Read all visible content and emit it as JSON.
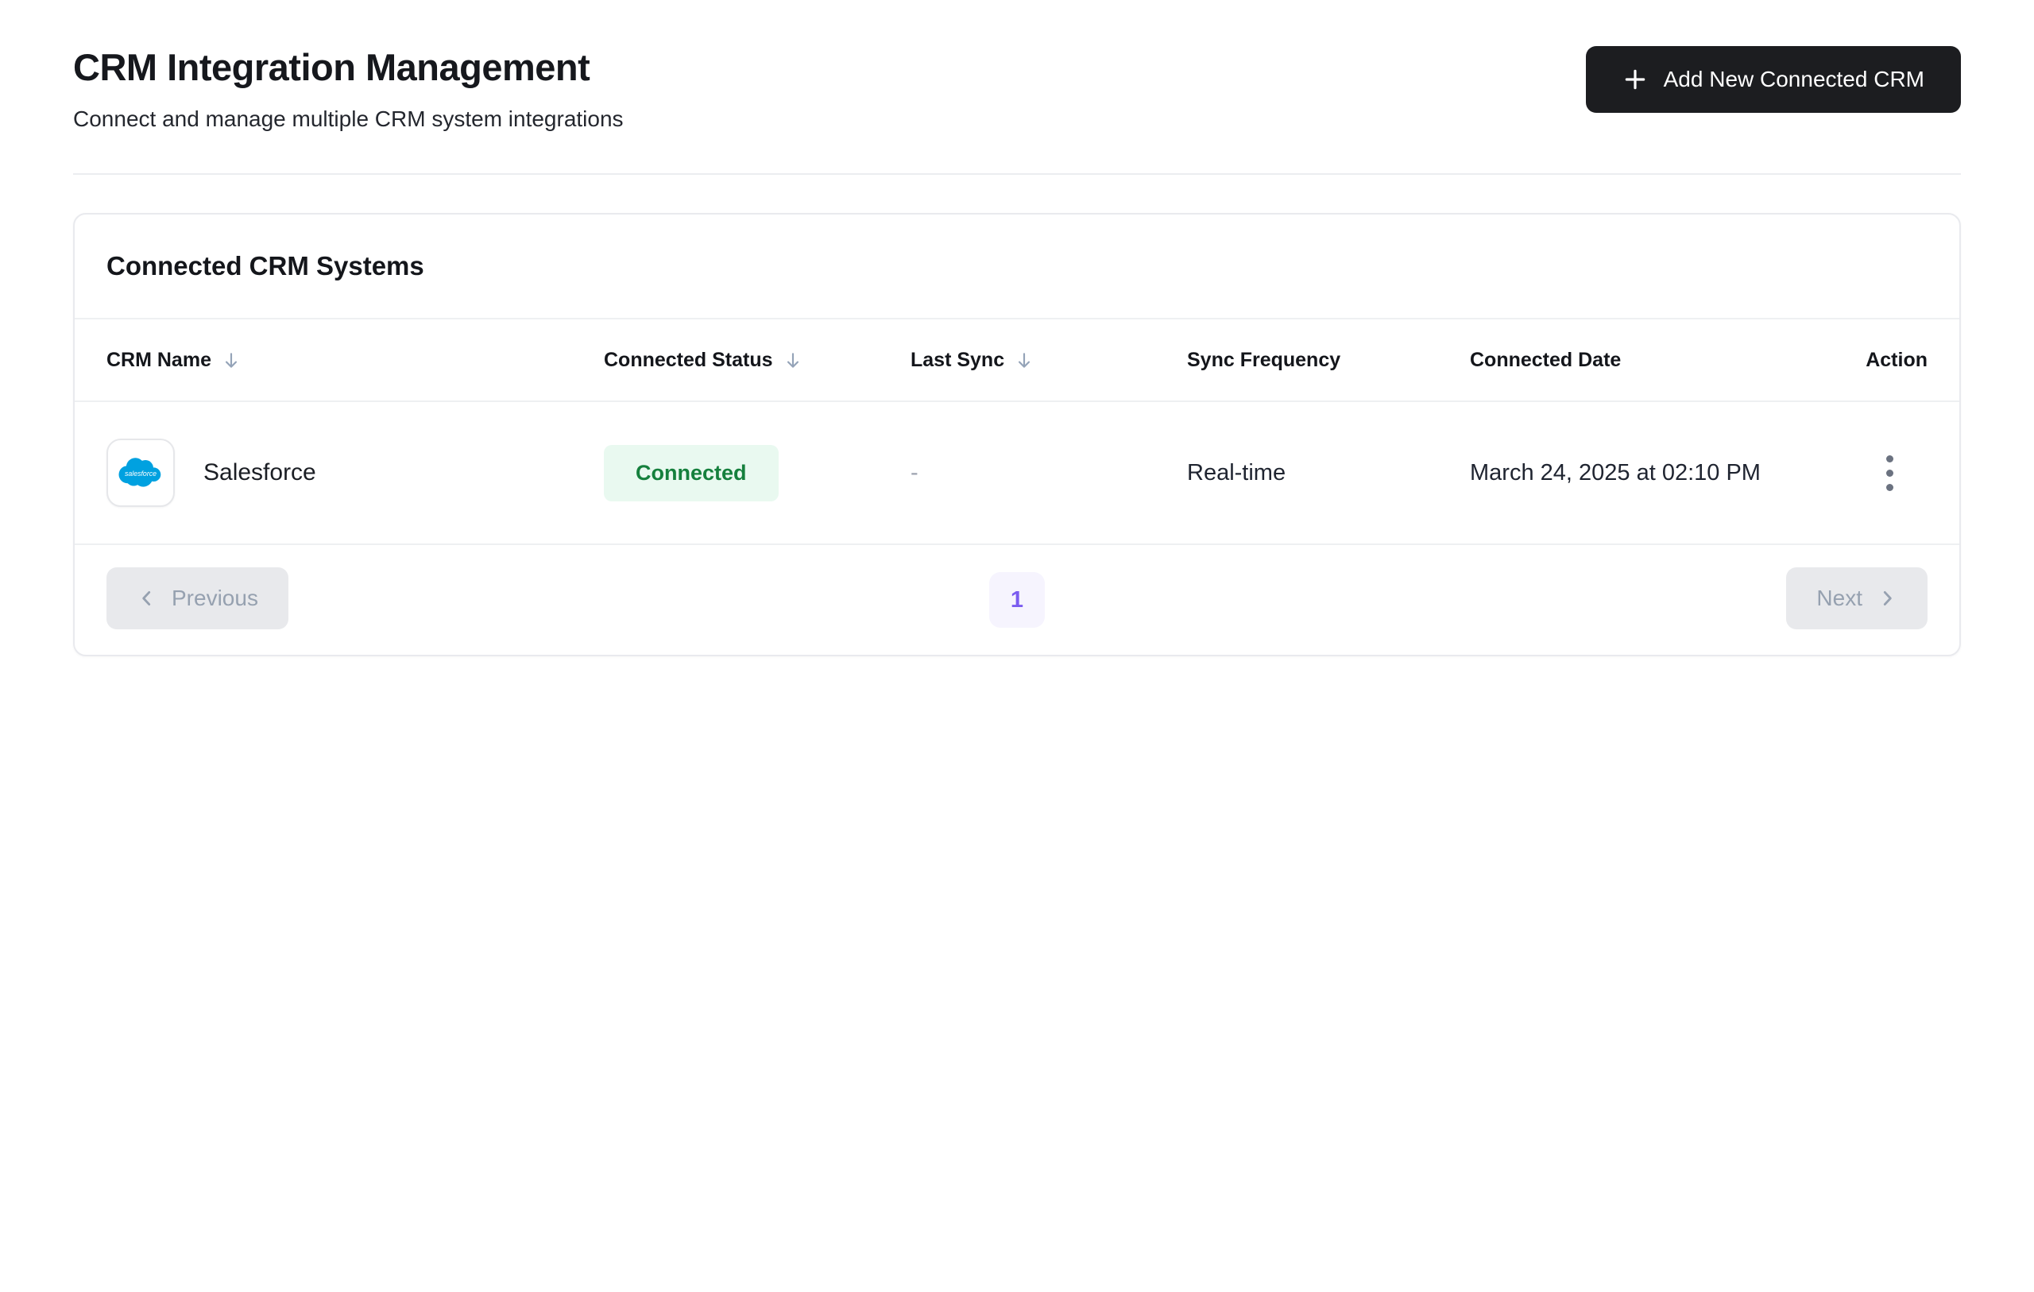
{
  "page": {
    "title": "CRM Integration Management",
    "subtitle": "Connect and manage multiple CRM system integrations"
  },
  "toolbar": {
    "add_button_label": "Add New Connected CRM"
  },
  "card": {
    "title": "Connected CRM Systems",
    "columns": [
      {
        "label": "CRM Name",
        "sortable": true
      },
      {
        "label": "Connected Status",
        "sortable": true
      },
      {
        "label": "Last Sync",
        "sortable": true
      },
      {
        "label": "Sync Frequency",
        "sortable": false
      },
      {
        "label": "Connected Date",
        "sortable": false
      },
      {
        "label": "Action",
        "sortable": false
      }
    ],
    "rows": [
      {
        "crm_name": "Salesforce",
        "logo_text": "salesforce",
        "status": "Connected",
        "last_sync": "-",
        "sync_frequency": "Real-time",
        "connected_date": "March 24, 2025 at 02:10 PM"
      }
    ]
  },
  "pagination": {
    "previous_label": "Previous",
    "current_page": "1",
    "next_label": "Next"
  },
  "colors": {
    "button_dark": "#1c1d20",
    "status_connected_bg": "#e9f9f0",
    "status_connected_text": "#15803d",
    "page_badge_bg": "#f6f4fe",
    "page_badge_text": "#7b5cf0",
    "salesforce_blue": "#00a1e0",
    "sort_arrow_gray": "#94a3b8",
    "disabled_button_bg": "#e8e9ec",
    "disabled_button_text": "#96a1b0"
  }
}
